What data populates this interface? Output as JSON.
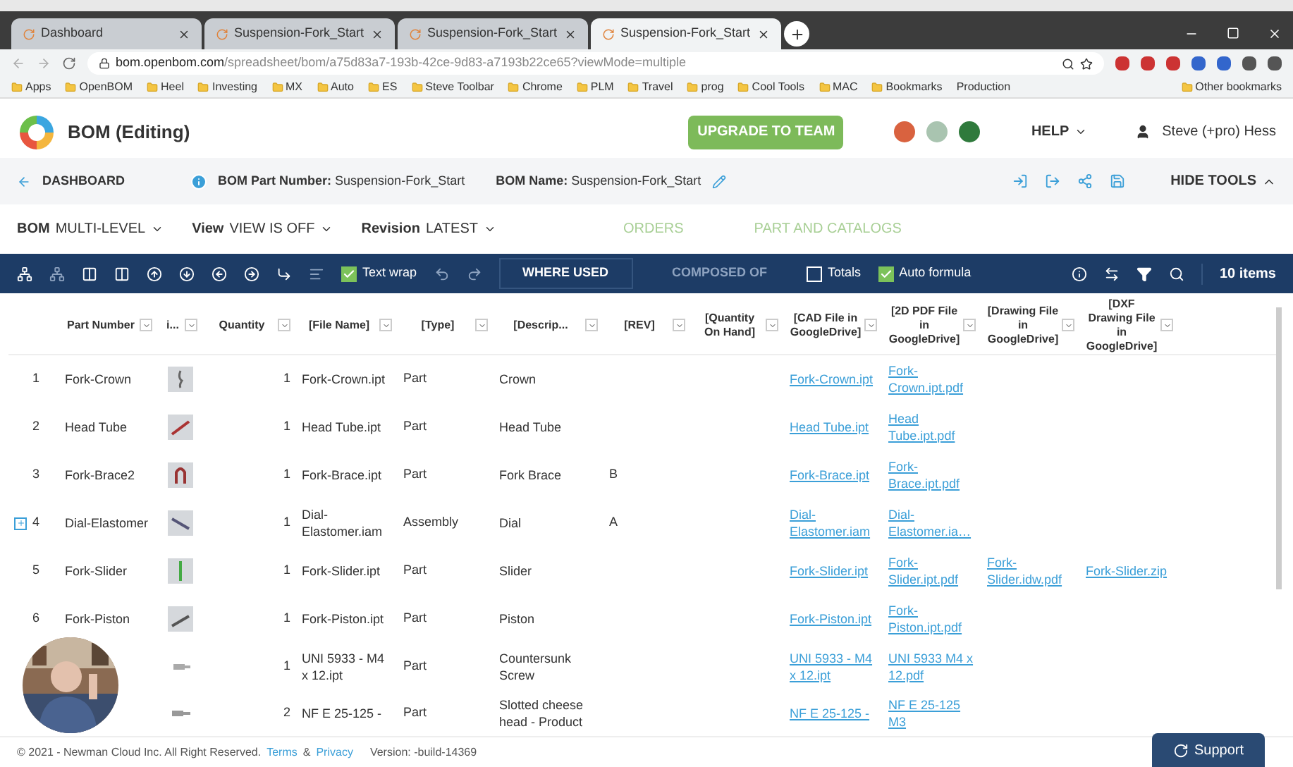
{
  "browser": {
    "tabs": [
      {
        "title": "Dashboard",
        "selected": false
      },
      {
        "title": "Suspension-Fork_Start",
        "selected": false
      },
      {
        "title": "Suspension-Fork_Start",
        "selected": false
      },
      {
        "title": "Suspension-Fork_Start",
        "selected": true
      }
    ],
    "url_host": "bom.openbom.com",
    "url_path": "/spreadsheet/bom/a75d83a7-193b-42ce-9d83-a7193b22ce65?viewMode=multiple",
    "bookmarks": [
      "Apps",
      "OpenBOM",
      "Heel",
      "Investing",
      "MX",
      "Auto",
      "ES",
      "Steve Toolbar",
      "Chrome",
      "PLM",
      "Travel",
      "prog",
      "Cool Tools",
      "MAC",
      "Bookmarks"
    ],
    "bookmarks_end": "Production",
    "other_bookmarks": "Other bookmarks"
  },
  "app": {
    "title": "BOM (Editing)",
    "upgrade": "UPGRADE TO TEAM",
    "avatars": [
      {
        "color": "#d9623f"
      },
      {
        "color": "#a9c4b0"
      },
      {
        "color": "#2f7a3c"
      }
    ],
    "help": "HELP",
    "user": "Steve (+pro) Hess"
  },
  "breadcrumb": {
    "back": "DASHBOARD",
    "part_label": "BOM Part Number:",
    "part_value": "Suspension-Fork_Start",
    "name_label": "BOM Name:",
    "name_value": "Suspension-Fork_Start",
    "hide_tools": "HIDE TOOLS"
  },
  "menu": {
    "selectors": [
      {
        "label": "BOM",
        "value": "MULTI-LEVEL"
      },
      {
        "label": "View",
        "value": "VIEW IS OFF"
      },
      {
        "label": "Revision",
        "value": "LATEST"
      }
    ],
    "links": [
      "ORDERS",
      "PART AND CATALOGS"
    ]
  },
  "toolbar": {
    "text_wrap": {
      "label": "Text wrap",
      "checked": true
    },
    "views": [
      {
        "label": "WHERE USED",
        "selected": true
      },
      {
        "label": "COMPOSED OF",
        "selected": false
      }
    ],
    "totals": {
      "label": "Totals",
      "checked": false
    },
    "auto_formula": {
      "label": "Auto formula",
      "checked": true
    },
    "count": "10 items"
  },
  "table": {
    "columns": [
      {
        "label": "Part Number"
      },
      {
        "label": "i..."
      },
      {
        "label": "Quantity"
      },
      {
        "label": "[File Name]"
      },
      {
        "label": "[Type]"
      },
      {
        "label": "[Descrip..."
      },
      {
        "label": "[REV]"
      },
      {
        "label": "[Quantity On Hand]"
      },
      {
        "label": "[CAD File in GoogleDrive]"
      },
      {
        "label": "[2D PDF File in GoogleDrive]"
      },
      {
        "label": "[Drawing File in GoogleDrive]"
      },
      {
        "label": "[DXF Drawing File in GoogleDrive]"
      }
    ],
    "rows": [
      {
        "index": "1",
        "part": "Fork-Crown",
        "has_children": false,
        "quantity": "1",
        "file": "Fork-Crown.ipt",
        "type": "Part",
        "description": "Crown",
        "cad": "Fork-Crown.ipt",
        "pdf": "Fork-Crown.ipt.pdf"
      },
      {
        "index": "2",
        "part": "Head Tube",
        "has_children": false,
        "quantity": "1",
        "file": "Head Tube.ipt",
        "type": "Part",
        "description": "Head Tube",
        "cad": "Head Tube.ipt",
        "pdf": "Head Tube.ipt.pdf"
      },
      {
        "index": "3",
        "part": "Fork-Brace2",
        "has_children": false,
        "quantity": "1",
        "file": "Fork-Brace.ipt",
        "type": "Part",
        "description": "Fork Brace",
        "rev": "B",
        "cad": "Fork-Brace.ipt",
        "pdf": "Fork-Brace.ipt.pdf"
      },
      {
        "index": "4",
        "part": "Dial-Elastomer",
        "has_children": true,
        "quantity": "1",
        "file": "Dial-Elastomer.iam",
        "type": "Assembly",
        "description": "Dial",
        "rev": "A",
        "cad": "Dial-Elastomer.iam",
        "pdf": "Dial-Elastomer.ia…"
      },
      {
        "index": "5",
        "part": "Fork-Slider",
        "has_children": false,
        "quantity": "1",
        "file": "Fork-Slider.ipt",
        "type": "Part",
        "description": "Slider",
        "cad": "Fork-Slider.ipt",
        "pdf": "Fork-Slider.ipt.pdf",
        "drawing": "Fork-Slider.idw.pdf",
        "dxf": "Fork-Slider.zip"
      },
      {
        "index": "6",
        "part": "Fork-Piston",
        "has_children": false,
        "quantity": "1",
        "file": "Fork-Piston.ipt",
        "type": "Part",
        "description": "Piston",
        "cad": "Fork-Piston.ipt",
        "pdf": "Fork-Piston.ipt.pdf"
      },
      {
        "has_children": false,
        "quantity": "1",
        "file": "UNI 5933 - M4 x 12.ipt",
        "type": "Part",
        "description": "Countersunk Screw",
        "cad": "UNI 5933 - M4 x 12.ipt",
        "pdf": "UNI 5933 M4 x 12.pdf"
      },
      {
        "has_children": false,
        "quantity": "2",
        "file": "NF E 25-125 -",
        "type": "Part",
        "description": "Slotted cheese head - Product",
        "cad": "NF E 25-125 -",
        "pdf": "NF E 25-125 M3"
      }
    ]
  },
  "footer": {
    "copyright": "© 2021 - Newman Cloud Inc. All Right Reserved.",
    "terms": "Terms",
    "amp": "&",
    "privacy": "Privacy",
    "version": "Version: -build-14369"
  },
  "support": "Support"
}
